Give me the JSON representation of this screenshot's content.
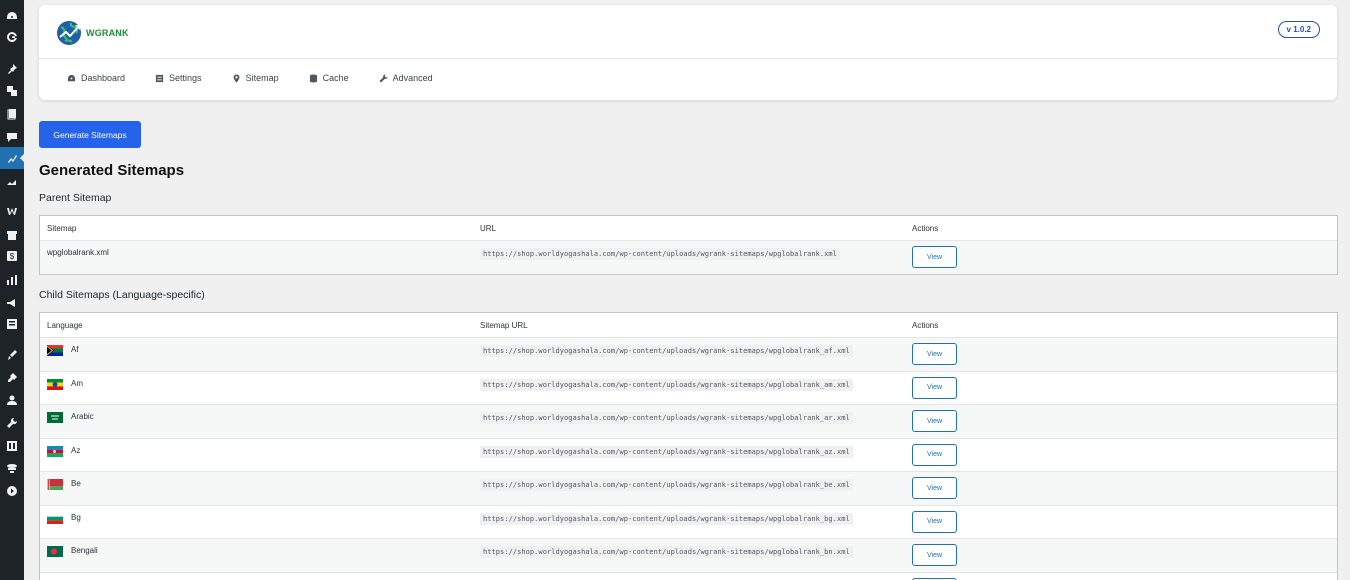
{
  "header": {
    "logo_wg": "WG",
    "logo_rank": "RANK",
    "version": "v 1.0.2"
  },
  "nav": [
    {
      "label": "Dashboard",
      "icon": "dashboard-icon"
    },
    {
      "label": "Settings",
      "icon": "settings-icon"
    },
    {
      "label": "Sitemap",
      "icon": "location-pin-icon"
    },
    {
      "label": "Cache",
      "icon": "database-icon"
    },
    {
      "label": "Advanced",
      "icon": "wrench-icon"
    }
  ],
  "actions": {
    "generate_label": "Generate Sitemaps"
  },
  "page_title": "Generated Sitemaps",
  "parent": {
    "title": "Parent Sitemap",
    "columns": [
      "Sitemap",
      "URL",
      "Actions"
    ],
    "rows": [
      {
        "name": "wpglobalrank.xml",
        "url": "https://shop.worldyogashala.com/wp-content/uploads/wgrank-sitemaps/wpglobalrank.xml",
        "action": "View"
      }
    ]
  },
  "child": {
    "title": "Child Sitemaps (Language-specific)",
    "columns": [
      "Language",
      "Sitemap URL",
      "Actions"
    ],
    "rows": [
      {
        "lang": "Af",
        "flag": "za",
        "url": "https://shop.worldyogashala.com/wp-content/uploads/wgrank-sitemaps/wpglobalrank_af.xml",
        "action": "View"
      },
      {
        "lang": "Am",
        "flag": "et",
        "url": "https://shop.worldyogashala.com/wp-content/uploads/wgrank-sitemaps/wpglobalrank_am.xml",
        "action": "View"
      },
      {
        "lang": "Arabic",
        "flag": "sa",
        "url": "https://shop.worldyogashala.com/wp-content/uploads/wgrank-sitemaps/wpglobalrank_ar.xml",
        "action": "View"
      },
      {
        "lang": "Az",
        "flag": "az",
        "url": "https://shop.worldyogashala.com/wp-content/uploads/wgrank-sitemaps/wpglobalrank_az.xml",
        "action": "View"
      },
      {
        "lang": "Be",
        "flag": "by",
        "url": "https://shop.worldyogashala.com/wp-content/uploads/wgrank-sitemaps/wpglobalrank_be.xml",
        "action": "View"
      },
      {
        "lang": "Bg",
        "flag": "bg",
        "url": "https://shop.worldyogashala.com/wp-content/uploads/wgrank-sitemaps/wpglobalrank_bg.xml",
        "action": "View"
      },
      {
        "lang": "Bengali",
        "flag": "bd",
        "url": "https://shop.worldyogashala.com/wp-content/uploads/wgrank-sitemaps/wpglobalrank_bn.xml",
        "action": "View"
      },
      {
        "lang": "",
        "flag": "partial",
        "url": "",
        "action": ""
      }
    ]
  }
}
